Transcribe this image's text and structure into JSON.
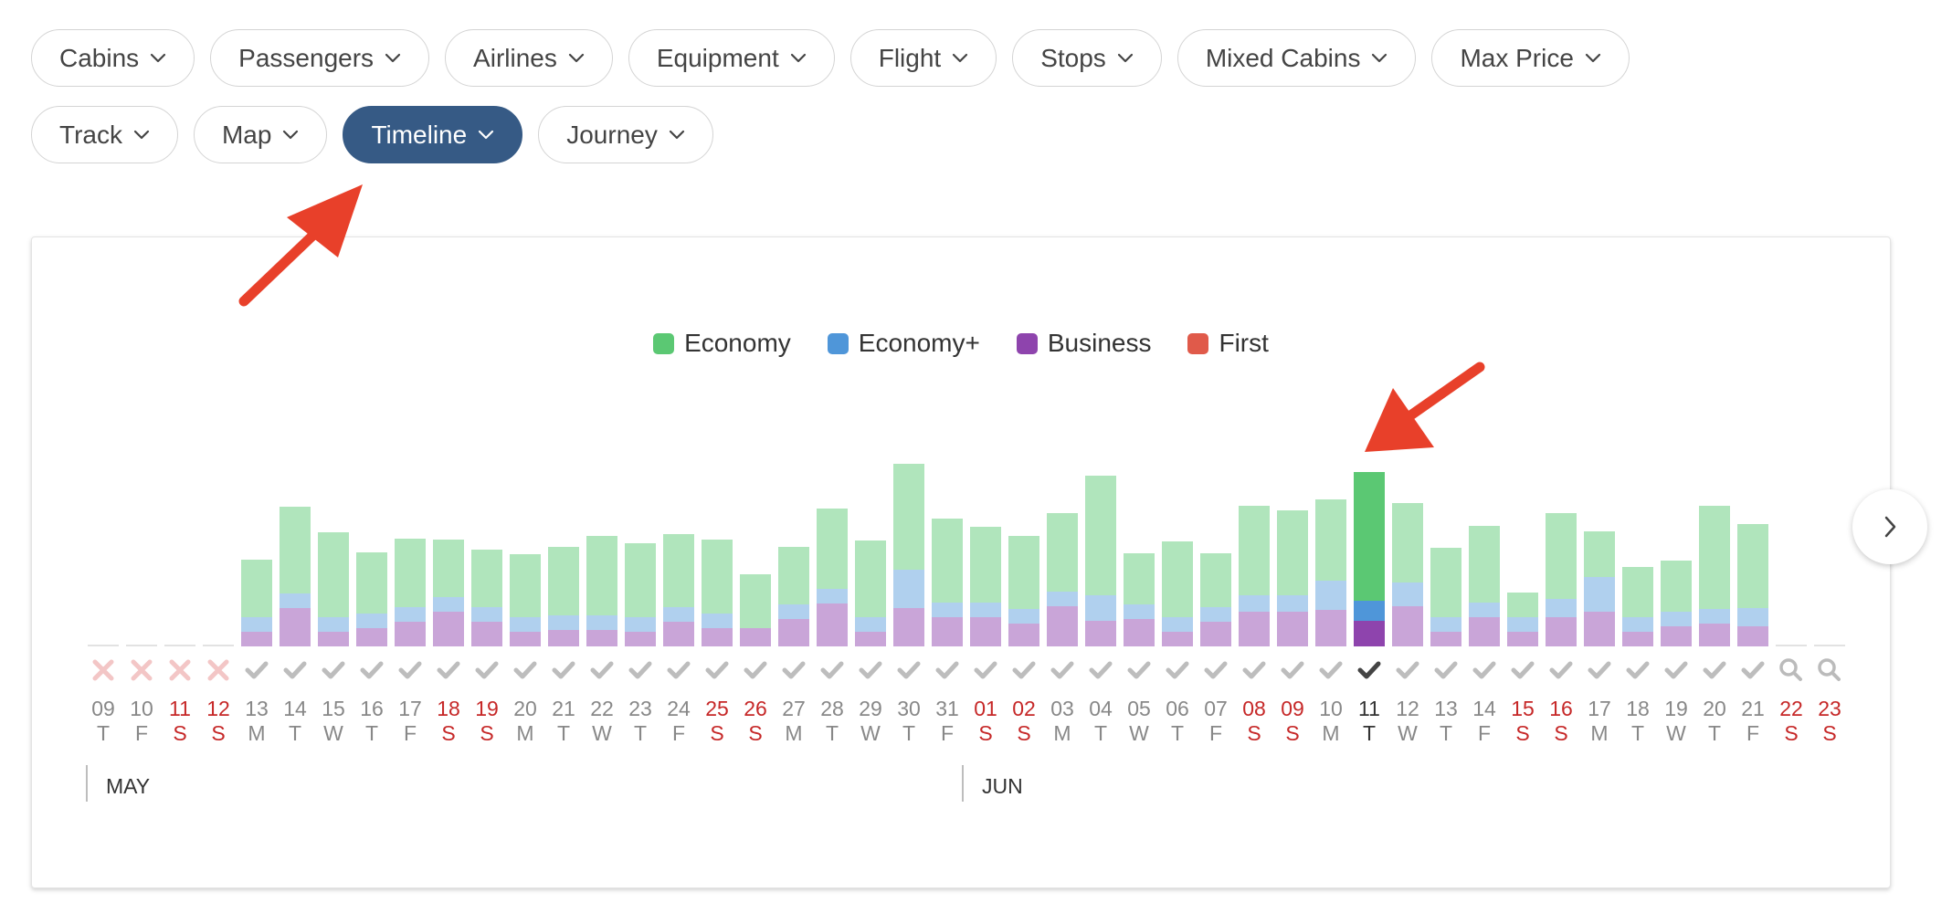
{
  "filters": {
    "row1": [
      {
        "id": "cabins",
        "label": "Cabins"
      },
      {
        "id": "passengers",
        "label": "Passengers"
      },
      {
        "id": "airlines",
        "label": "Airlines"
      },
      {
        "id": "equipment",
        "label": "Equipment"
      },
      {
        "id": "flight",
        "label": "Flight"
      },
      {
        "id": "stops",
        "label": "Stops"
      },
      {
        "id": "mixed-cabins",
        "label": "Mixed Cabins"
      },
      {
        "id": "max-price",
        "label": "Max Price"
      }
    ],
    "row2": [
      {
        "id": "track",
        "label": "Track",
        "active": false
      },
      {
        "id": "map",
        "label": "Map",
        "active": false
      },
      {
        "id": "timeline",
        "label": "Timeline",
        "active": true
      },
      {
        "id": "journey",
        "label": "Journey",
        "active": false
      }
    ]
  },
  "colors": {
    "economy": "#5bc873",
    "economy_plus": "#4f96d9",
    "business": "#8e44ad",
    "first": "#e05a4a",
    "active_pill": "#365a85",
    "weekend_text": "#c62828",
    "annotation": "#e8402a"
  },
  "chart_data": {
    "type": "bar",
    "stacked": true,
    "legend": [
      "Economy",
      "Economy+",
      "Business",
      "First"
    ],
    "legend_position": "top-center",
    "selected_date": "11",
    "months": [
      {
        "label": "MAY",
        "start_index": 0
      },
      {
        "label": "JUN",
        "start_index": 23
      }
    ],
    "days": [
      {
        "date": "09",
        "dow": "T",
        "weekend": false,
        "status": "none",
        "business": 0,
        "economy_plus": 0,
        "economy": 0
      },
      {
        "date": "10",
        "dow": "F",
        "weekend": false,
        "status": "none",
        "business": 0,
        "economy_plus": 0,
        "economy": 0
      },
      {
        "date": "11",
        "dow": "S",
        "weekend": true,
        "status": "none",
        "business": 0,
        "economy_plus": 0,
        "economy": 0
      },
      {
        "date": "12",
        "dow": "S",
        "weekend": true,
        "status": "none",
        "business": 0,
        "economy_plus": 0,
        "economy": 0
      },
      {
        "date": "13",
        "dow": "M",
        "weekend": false,
        "status": "check",
        "business": 16,
        "economy_plus": 16,
        "economy": 63
      },
      {
        "date": "14",
        "dow": "T",
        "weekend": false,
        "status": "check",
        "business": 42,
        "economy_plus": 16,
        "economy": 95
      },
      {
        "date": "15",
        "dow": "W",
        "weekend": false,
        "status": "check",
        "business": 16,
        "economy_plus": 16,
        "economy": 93
      },
      {
        "date": "16",
        "dow": "T",
        "weekend": false,
        "status": "check",
        "business": 20,
        "economy_plus": 16,
        "economy": 67
      },
      {
        "date": "17",
        "dow": "F",
        "weekend": false,
        "status": "check",
        "business": 27,
        "economy_plus": 16,
        "economy": 75
      },
      {
        "date": "18",
        "dow": "S",
        "weekend": true,
        "status": "check",
        "business": 38,
        "economy_plus": 16,
        "economy": 63
      },
      {
        "date": "19",
        "dow": "S",
        "weekend": true,
        "status": "check",
        "business": 27,
        "economy_plus": 16,
        "economy": 63
      },
      {
        "date": "20",
        "dow": "M",
        "weekend": false,
        "status": "check",
        "business": 16,
        "economy_plus": 16,
        "economy": 69
      },
      {
        "date": "21",
        "dow": "T",
        "weekend": false,
        "status": "check",
        "business": 18,
        "economy_plus": 16,
        "economy": 75
      },
      {
        "date": "22",
        "dow": "W",
        "weekend": false,
        "status": "check",
        "business": 18,
        "economy_plus": 16,
        "economy": 87
      },
      {
        "date": "23",
        "dow": "T",
        "weekend": false,
        "status": "check",
        "business": 16,
        "economy_plus": 16,
        "economy": 81
      },
      {
        "date": "24",
        "dow": "F",
        "weekend": false,
        "status": "check",
        "business": 27,
        "economy_plus": 16,
        "economy": 80
      },
      {
        "date": "25",
        "dow": "S",
        "weekend": true,
        "status": "check",
        "business": 20,
        "economy_plus": 16,
        "economy": 81
      },
      {
        "date": "26",
        "dow": "S",
        "weekend": true,
        "status": "check",
        "business": 20,
        "economy_plus": 0,
        "economy": 59
      },
      {
        "date": "27",
        "dow": "M",
        "weekend": false,
        "status": "check",
        "business": 30,
        "economy_plus": 16,
        "economy": 63
      },
      {
        "date": "28",
        "dow": "T",
        "weekend": false,
        "status": "check",
        "business": 47,
        "economy_plus": 16,
        "economy": 88
      },
      {
        "date": "29",
        "dow": "W",
        "weekend": false,
        "status": "check",
        "business": 16,
        "economy_plus": 16,
        "economy": 84
      },
      {
        "date": "30",
        "dow": "T",
        "weekend": false,
        "status": "check",
        "business": 42,
        "economy_plus": 42,
        "economy": 116
      },
      {
        "date": "31",
        "dow": "F",
        "weekend": false,
        "status": "check",
        "business": 32,
        "economy_plus": 16,
        "economy": 92
      },
      {
        "date": "01",
        "dow": "S",
        "weekend": true,
        "status": "check",
        "business": 32,
        "economy_plus": 16,
        "economy": 83
      },
      {
        "date": "02",
        "dow": "S",
        "weekend": true,
        "status": "check",
        "business": 25,
        "economy_plus": 16,
        "economy": 80
      },
      {
        "date": "03",
        "dow": "M",
        "weekend": false,
        "status": "check",
        "business": 44,
        "economy_plus": 16,
        "economy": 86
      },
      {
        "date": "04",
        "dow": "T",
        "weekend": false,
        "status": "check",
        "business": 28,
        "economy_plus": 28,
        "economy": 131
      },
      {
        "date": "05",
        "dow": "W",
        "weekend": false,
        "status": "check",
        "business": 30,
        "economy_plus": 16,
        "economy": 56
      },
      {
        "date": "06",
        "dow": "T",
        "weekend": false,
        "status": "check",
        "business": 16,
        "economy_plus": 16,
        "economy": 83
      },
      {
        "date": "07",
        "dow": "F",
        "weekend": false,
        "status": "check",
        "business": 27,
        "economy_plus": 16,
        "economy": 59
      },
      {
        "date": "08",
        "dow": "S",
        "weekend": true,
        "status": "check",
        "business": 38,
        "economy_plus": 18,
        "economy": 98
      },
      {
        "date": "09",
        "dow": "S",
        "weekend": true,
        "status": "check",
        "business": 38,
        "economy_plus": 18,
        "economy": 93
      },
      {
        "date": "10",
        "dow": "M",
        "weekend": false,
        "status": "check",
        "business": 40,
        "economy_plus": 32,
        "economy": 89
      },
      {
        "date": "11",
        "dow": "T",
        "weekend": false,
        "status": "selected",
        "business": 28,
        "economy_plus": 22,
        "economy": 141
      },
      {
        "date": "12",
        "dow": "W",
        "weekend": false,
        "status": "check",
        "business": 44,
        "economy_plus": 26,
        "economy": 87
      },
      {
        "date": "13",
        "dow": "T",
        "weekend": false,
        "status": "check",
        "business": 16,
        "economy_plus": 16,
        "economy": 76
      },
      {
        "date": "14",
        "dow": "F",
        "weekend": false,
        "status": "check",
        "business": 32,
        "economy_plus": 16,
        "economy": 84
      },
      {
        "date": "15",
        "dow": "S",
        "weekend": true,
        "status": "check",
        "business": 16,
        "economy_plus": 16,
        "economy": 27
      },
      {
        "date": "16",
        "dow": "S",
        "weekend": true,
        "status": "check",
        "business": 32,
        "economy_plus": 20,
        "economy": 94
      },
      {
        "date": "17",
        "dow": "M",
        "weekend": false,
        "status": "check",
        "business": 38,
        "economy_plus": 38,
        "economy": 50
      },
      {
        "date": "18",
        "dow": "T",
        "weekend": false,
        "status": "check",
        "business": 16,
        "economy_plus": 16,
        "economy": 55
      },
      {
        "date": "19",
        "dow": "W",
        "weekend": false,
        "status": "check",
        "business": 22,
        "economy_plus": 16,
        "economy": 56
      },
      {
        "date": "20",
        "dow": "T",
        "weekend": false,
        "status": "check",
        "business": 25,
        "economy_plus": 16,
        "economy": 113
      },
      {
        "date": "21",
        "dow": "F",
        "weekend": false,
        "status": "check",
        "business": 22,
        "economy_plus": 20,
        "economy": 92
      },
      {
        "date": "22",
        "dow": "S",
        "weekend": true,
        "status": "search",
        "business": 0,
        "economy_plus": 0,
        "economy": 0
      },
      {
        "date": "23",
        "dow": "S",
        "weekend": true,
        "status": "search",
        "business": 0,
        "economy_plus": 0,
        "economy": 0
      }
    ]
  }
}
